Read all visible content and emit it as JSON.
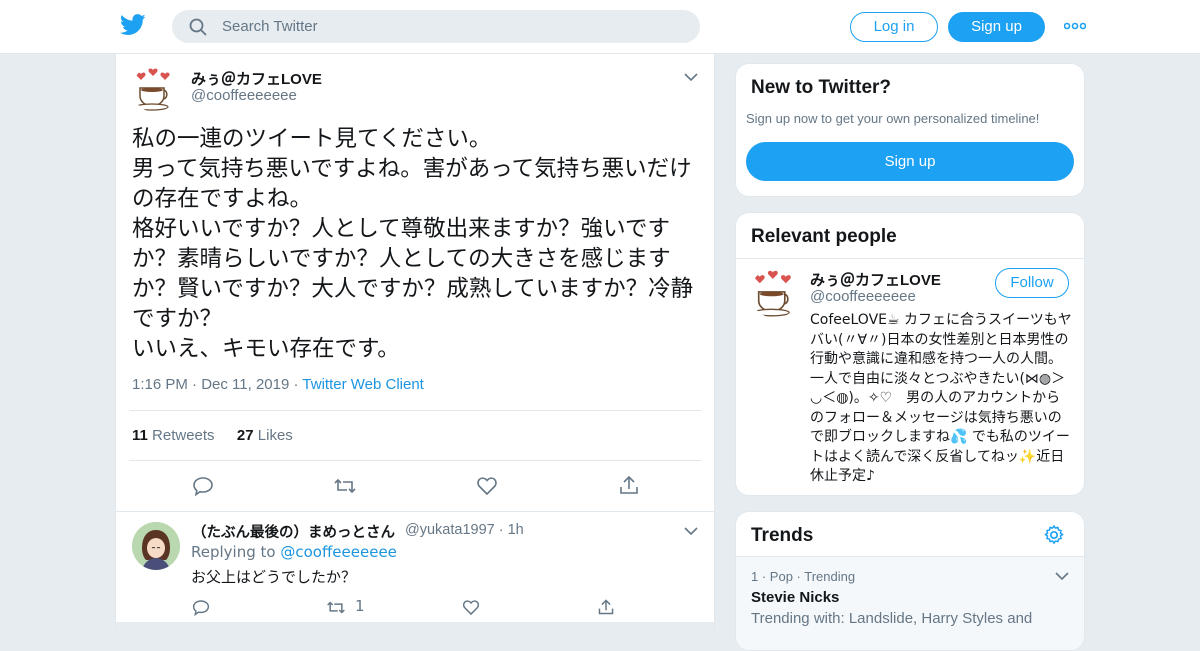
{
  "colors": {
    "accent": "#1da1f2",
    "link": "#1b95e0",
    "muted": "#657786",
    "background": "#e6ecf0"
  },
  "header": {
    "search_placeholder": "Search Twitter",
    "login_label": "Log in",
    "signup_label": "Sign up",
    "logo_icon": "twitter-bird-icon",
    "more_icon": "more-dots-icon"
  },
  "tweet": {
    "author_name": "みぅ＠カフェLOVE",
    "author_handle": "@cooffeeeeeee",
    "text": "私の一連のツイート見てください。\n男って気持ち悪いですよね。害があって気持ち悪いだけの存在ですよね。\n格好いいですか？人として尊敬出来ますか？強いですか？素晴らしいですか？人としての大きさを感じますか？賢いですか？大人ですか？成熟していますか？冷静ですか？\nいいえ、キモい存在です。",
    "time": "1:16 PM",
    "date": "Dec 11, 2019",
    "source": "Twitter Web Client",
    "retweets_count": "11",
    "retweets_label": "Retweets",
    "likes_count": "27",
    "likes_label": "Likes"
  },
  "reply": {
    "author_name": "（たぶん最後の）まめっとさん",
    "author_handle": "@yukata1997",
    "time_ago": "1h",
    "replying_label": "Replying to",
    "replying_to": "@cooffeeeeeee",
    "text": "お父上はどうでしたか？",
    "retweet_count": "1"
  },
  "sidebar": {
    "new_to_twitter": {
      "title": "New to Twitter?",
      "subtitle": "Sign up now to get your own personalized timeline!",
      "signup_label": "Sign up"
    },
    "relevant_people": {
      "title": "Relevant people",
      "name": "みぅ＠カフェLOVE",
      "handle": "@cooffeeeeeee",
      "follow_label": "Follow",
      "bio": "CofeeLOVE☕ カフェに合うスイーツもヤバい(〃∀〃)日本の女性差別と日本男性の行動や意識に違和感を持つ一人の人間。一人で自由に淡々とつぶやきたい(⋈◍＞◡＜◍)。✧♡　男の人のアカウントからのフォロー＆メッセージは気持ち悪いので即ブロックしますね💦 でも私のツイートはよく読んで深く反省してねッ✨近日休止予定♪"
    },
    "trends": {
      "title": "Trends",
      "items": [
        {
          "rank": "1",
          "category": "Pop",
          "status": "Trending",
          "name": "Stevie Nicks",
          "trending_with": "Trending with: Landslide, Harry Styles and"
        }
      ]
    }
  }
}
